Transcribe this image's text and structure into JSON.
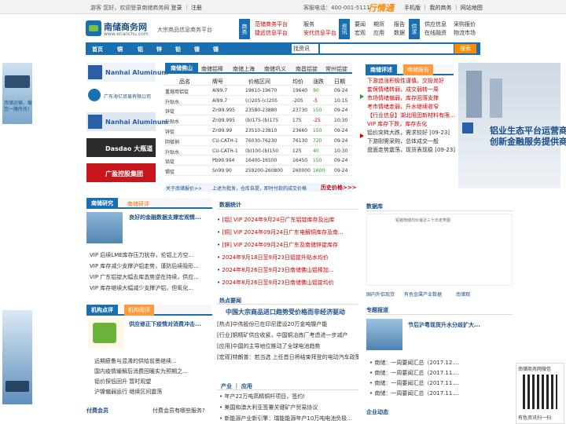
{
  "topbar": {
    "welcome": "游客 您好，欢迎登录南储商务网",
    "login": "登录",
    "register": "注册",
    "hotline": "客服电话：400-001-5111",
    "brand2": "行情通",
    "nav": "手机版 ｜ 我的商务 ｜ 网站地图"
  },
  "header": {
    "logo_title": "南储商务网",
    "logo_url": "www.enanchu.com",
    "slogan": "大宗商品信息商务平台",
    "biz_tag": "商务",
    "biz_col1": [
      "范储商务平台",
      "捷远信息平台"
    ],
    "biz_col2": [
      "服务",
      "安代信息平台"
    ],
    "info_tag": "资讯",
    "info_col1": [
      "要闻",
      "宏观"
    ],
    "info_col2": [
      "期货",
      "应用"
    ],
    "info_col3": [
      "报告",
      "数据"
    ],
    "supply_tag": "供求",
    "supply_col1": [
      "供应信息",
      "在线融资"
    ],
    "supply_col2": [
      "采购报价",
      "物流市场"
    ]
  },
  "navbar": {
    "items": [
      "首页",
      "铜",
      "铝",
      "锌",
      "铅",
      "镍",
      "锡"
    ],
    "search_select": "找资讯",
    "search_button": "搜索"
  },
  "left": {
    "banner_text": "南储运输，载您一路所托！",
    "logos": [
      "Nanhai Aluminum",
      "广东海亿贸易有限公司",
      "Nanhai Aluminum",
      "Dasdao 大瓶道",
      "广盈控股集团"
    ],
    "research_tabs": [
      "南储研究",
      "南储研评"
    ],
    "research_headline": "良好的金融数据支撑宏观情...",
    "research_items": [
      "VIP  后续LME库存压力犹存，伦铝上方空...",
      "VIP  库存减少支撑沪铝走势，谨防后续隐形...",
      "VIP  广东铝锭大幅去库态势逆在持续，供应...",
      "VIP  库存继续大幅减少支撑沪铝，但氧化..."
    ],
    "opinion_tabs": [
      "机构点评",
      "机构观评"
    ],
    "opinion_headline": "供应修正下疫情对消费冲击...",
    "opinion_items": [
      "远期疲惫与混淆的供给前景继续...",
      "国内疫情缓解后消费回暖实为预期之...",
      "铝价探低回升 暂时观望",
      "沪镍偏弱运行 继续区间震荡"
    ],
    "member_title": "付费会员",
    "member_link": "付费会员有哪些服务?"
  },
  "market": {
    "tabs": [
      "南储佛山",
      "南储铝棒",
      "南储上海",
      "南储巩义",
      "南昌铝锭",
      "常州铝锭"
    ],
    "headers": [
      "品名",
      "牌号",
      "价格区间",
      "均价",
      "涨跌",
      "日期"
    ],
    "rows": [
      [
        "重熔用铝锭",
        "Al99.7",
        "19610-19670",
        "19640",
        "90",
        "09-24"
      ],
      [
        "升贴水",
        "Al99.7",
        "(c)205-(c)205",
        "-205",
        "-5",
        "10:15"
      ],
      [
        "锌锭",
        "Zn99.995",
        "23580-23880",
        "23730",
        "150",
        "09-24"
      ],
      [
        "升贴水",
        "Zn99.995",
        "(b)175-(b)175",
        "175",
        "-25",
        "10:30"
      ],
      [
        "锌锭",
        "Zn99.99",
        "23510-23810",
        "23660",
        "150",
        "09-24"
      ],
      [
        "阴极铜",
        "CU-CATH-1",
        "76030-76230",
        "76130",
        "720",
        "09-24"
      ],
      [
        "升贴水",
        "CU-CATH-1",
        "(b)100-(b)150",
        "125",
        "40",
        "10:30"
      ],
      [
        "铅锭",
        "Pb99.994",
        "16400-16500",
        "16450",
        "150",
        "09-24"
      ],
      [
        "锡锭",
        "Sn99.90",
        "259200-260800",
        "260000",
        "1600",
        "09-24"
      ]
    ],
    "footer_left": "关于南储报价>>",
    "footer_mid": "上述为批发，仓库自提，即时付款的成交价格",
    "footer_right": "历史价格>>>"
  },
  "datastats": {
    "title": "数据统计",
    "items": [
      "[铝] VIP 2024年9月24日广东铝锭库存及出库",
      "[铜] VIP 2024年09月24日广东电解铜库存及南...",
      "[锌] VIP 2024年09月24日广东及南储锌锭库存",
      "2024年9月18日至9月23日铝锭升贴水均价",
      "2024年8月26日至9月23日南储佛山铝棒加...",
      "2024年8月26日至9月23日南储佛山铝锭均价"
    ]
  },
  "hot": {
    "title": "热点要闻",
    "headline": "中国大宗商品进口趋势受价格而非经济驱动",
    "items": [
      "[热点]中伟股份已在印尼建设20万金吨镍产能",
      "[行业]铜精矿供应收紧，中国铜冶炼厂考虑进一步减产",
      "[应用]中国的主导地位推动了全球电池趋势",
      "[宏观]特朗普：若当选 上任首日将结束拜登的电动汽车政策"
    ]
  },
  "industry": {
    "title": "产业 ｜ 应用",
    "items": [
      "年产22万吨高精铜杆项目，签约!",
      "美国和澳大利亚签署关键矿产贸易协议",
      "新能源产业新引擎：瑞能能源年产10万吨电池负极..."
    ]
  },
  "right": {
    "review_tabs": [
      "南储评述",
      "南储报告"
    ],
    "review_items": [
      "下游追涨积极性谨慎，交投尚好",
      "套保情绪转弱，成交弱转一周",
      "市场情绪偏弱，库存回落支撑",
      "考市情绪走弱，升水继续收窄",
      "【行业信息】湖北阻固新材料有限...",
      "VIP 库存下跌，库存去化",
      "铝价突转大跌，需求较好 [09-23]",
      "下游刚需采购，总体成交一般",
      "盘面走势震荡，现货表现稳 [09-23]"
    ],
    "ad_title": "铝业生态平台运营商",
    "ad_sub": "创新金融服务提供商",
    "db_title": "数据库",
    "db_caption": "铝锭南储均价最近三十日走势图",
    "db_tabs": [
      "国内外铝现货",
      "有色金属产业数据",
      "南储观"
    ],
    "special_title": "专题报道",
    "special_headline": "节后沪粤现货升水分歧扩大...",
    "special_items": [
      "南储：一周要闻汇总（2017.12....",
      "南储：一周要闻汇总（2017.11....",
      "南储：一周要闻汇总（2017.11....",
      "南储：一周要闻汇总（2017.11...."
    ],
    "company_title": "企业动态"
  },
  "qr": {
    "title": "南储商务网微信",
    "caption": "有色资讯扫一扫"
  },
  "colors": {
    "brand_blue": "#1a6fb0",
    "accent_orange": "#ff8a00",
    "price_up": "#2a9a2a",
    "price_down": "#c00000"
  }
}
